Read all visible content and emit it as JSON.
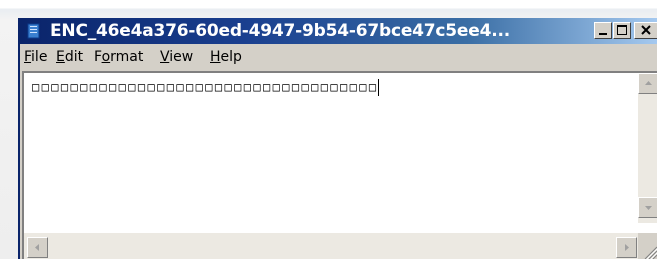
{
  "window": {
    "title": "ENC_46e4a376-60ed-4947-9b54-67bce47c5ee4...",
    "app_icon": "notepad-icon",
    "controls": {
      "minimize": "minimize-icon",
      "maximize": "maximize-icon",
      "close": "close-icon"
    }
  },
  "menubar": {
    "items": [
      {
        "label_ul": "F",
        "label_rest": "ile"
      },
      {
        "label_ul": "E",
        "label_rest": "dit"
      },
      {
        "label_pre": "F",
        "label_ul": "o",
        "label_rest": "rmat"
      },
      {
        "label_ul": "V",
        "label_rest": "iew"
      },
      {
        "label_ul": "H",
        "label_rest": "elp"
      }
    ]
  },
  "editor": {
    "content": "□□□□□□□□□□□□□□□□□□□□□□□□□□□□□□□□□□□□"
  },
  "scrollbars": {
    "vertical": {
      "up": "scroll-up-arrow-icon",
      "down": "scroll-down-arrow-icon"
    },
    "horizontal": {
      "left": "scroll-left-arrow-icon",
      "right": "scroll-right-arrow-icon"
    },
    "grip": "resize-grip-icon"
  },
  "colors": {
    "titlebar_start": "#0a246a",
    "titlebar_end": "#a6caf0",
    "chrome": "#d4d0c8",
    "editor_bg": "#ffffff"
  }
}
